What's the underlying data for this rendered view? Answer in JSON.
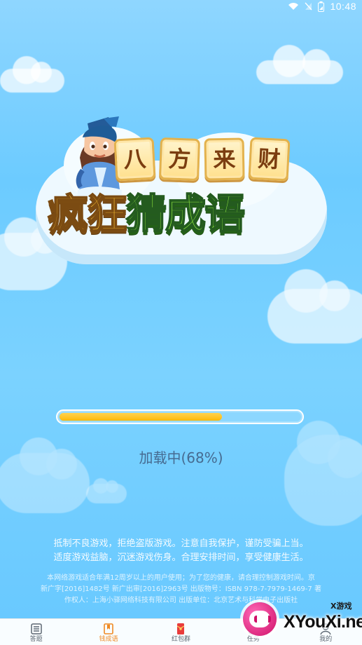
{
  "status_bar": {
    "time": "10:48",
    "icons": [
      "wifi-icon",
      "signal-muted-icon",
      "battery-icon"
    ]
  },
  "logo": {
    "subtitle_chars": [
      "八",
      "方",
      "来",
      "财"
    ],
    "title_chars": [
      "疯",
      "狂",
      "猜",
      "成",
      "语"
    ]
  },
  "progress": {
    "value": 0.68,
    "text": "加载中(68%)"
  },
  "notice": {
    "line1": "抵制不良游戏，拒绝盗版游戏。注意自我保护，谨防受骗上当。",
    "line2": "适度游戏益脑，沉迷游戏伤身。合理安排时间，享受健康生活。"
  },
  "license": {
    "line1": "本网络游戏适合年满12周岁以上的用户使用；为了您的健康，请合理控制游戏时间。京",
    "line2": "新广字[2016]1482号  新广出审[2016]2963号  出版物号：ISBN 978-7-7979-1469-7  著",
    "line3": "作权人：上海小驿网络科技有限公司  出版单位：北京艺术与科学电子出版社"
  },
  "bottom_nav": {
    "items": [
      {
        "label": "答题",
        "icon": "list-icon"
      },
      {
        "label": "钱成语",
        "icon": "book-icon"
      },
      {
        "label": "红包群",
        "icon": "red-envelope-icon"
      },
      {
        "label": "任务",
        "icon": "task-icon"
      },
      {
        "label": "我的",
        "icon": "user-icon"
      }
    ]
  },
  "watermark": {
    "small_text": "X游戏",
    "main_text": "XYouXi.net"
  },
  "colors": {
    "sky_top": "#8fd6ff",
    "sky_bottom": "#67c8ff",
    "progress": "#ffb90a",
    "loading_text": "#466b91",
    "active_nav": "#ef8a23"
  }
}
